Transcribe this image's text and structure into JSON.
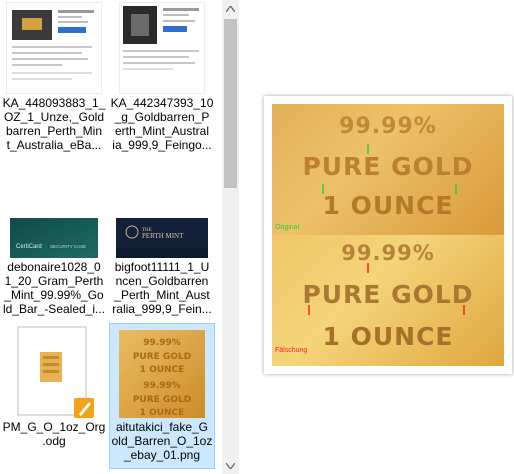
{
  "files": [
    {
      "name": "KA_448093883_1_OZ_1_Unze_Gold barren_Perth_Mint_Australia_eBa...",
      "lines": [
        "KA_448093883_1_",
        "OZ_1_Unze,_Gold",
        "barren_Perth_Min",
        "t_Australia_eBa..."
      ],
      "thumb": "webpage-screenshot"
    },
    {
      "name": "KA_442347393_10_g_Goldbarren_Perth_Mint_Australia_999,9_Feingo...",
      "lines": [
        "KA_442347393_10",
        "_g_Goldbarren_P",
        "erth_Mint_Austral",
        "ia_999,9_Feingo..."
      ],
      "thumb": "webpage-screenshot"
    },
    {
      "name": "debonaire1028_0_1_20_Gram_Perth_Mint_99.99%_Gold_Bar_-Sealed_i...",
      "lines": [
        "debonaire1028_0",
        "1_20_Gram_Perth",
        "_Mint_99.99%_Go",
        "ld_Bar_-Sealed_i..."
      ],
      "thumb": "certicard-photo",
      "thumb_text": "CertiCard SECURITY CASE"
    },
    {
      "name": "bigfoot11111_1_Uncen_Goldbarren_Perth_Mint_Australia_999,9_Fein...",
      "lines": [
        "bigfoot11111_1_U",
        "ncen_Goldbarren",
        "_Perth_Mint_Aust",
        "ralia_999,9_Fein..."
      ],
      "thumb": "perth-mint-photo",
      "thumb_text": "THE PERTH MINT"
    },
    {
      "name": "PM_G_O_1oz_Org.odg",
      "lines": [
        "PM_G_O_1oz_Org",
        ".odg"
      ],
      "thumb": "odg-document"
    },
    {
      "name": "aitutakici_fake_Gold_Barren_O_1oz_ebay_01.png",
      "lines": [
        "aitutakici_fake_G",
        "old_Barren_O_1oz",
        "_ebay_01.png"
      ],
      "thumb": "gold-comparison",
      "selected": true
    }
  ],
  "preview": {
    "top": {
      "lines": [
        "99.99%",
        "PURE GOLD",
        "1 OUNCE"
      ],
      "caption": "Original",
      "caption_color": "#2ecc40",
      "marker_color": "#2ecc40"
    },
    "bottom": {
      "lines": [
        "99.99%",
        "PURE GOLD",
        "1 OUNCE"
      ],
      "caption": "Fälschung",
      "caption_color": "#ff2020",
      "marker_color": "#ff2020"
    }
  },
  "colors": {
    "selection": "#cce8ff",
    "gold_light": "#e8b85a",
    "gold_dark": "#c98a22",
    "gold_text": "#b8771c"
  }
}
